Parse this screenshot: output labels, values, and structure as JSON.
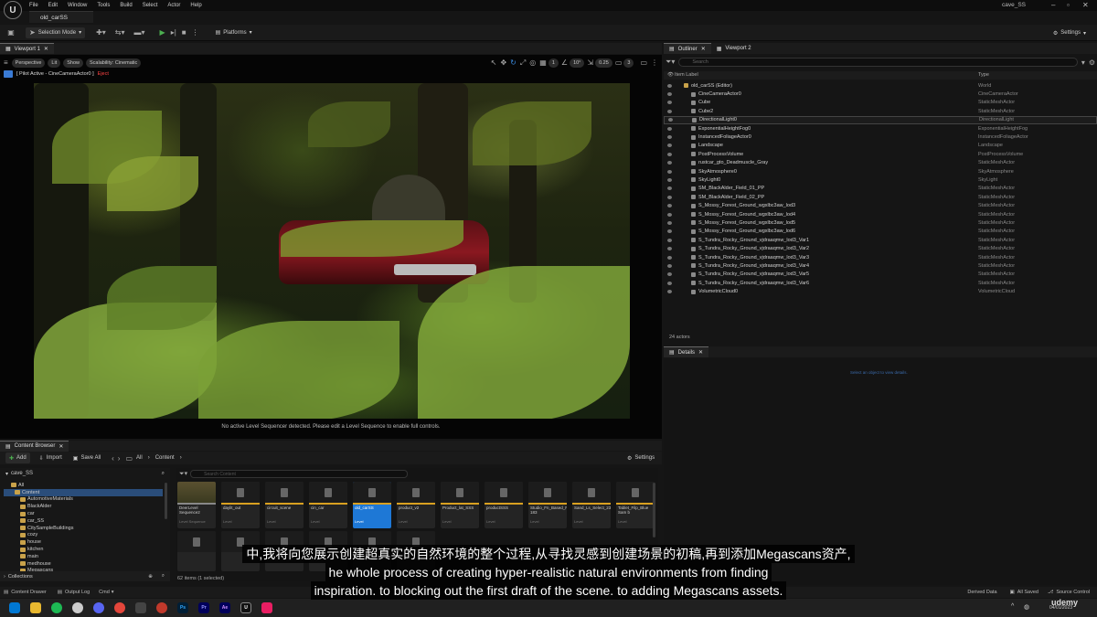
{
  "window": {
    "project_tab": "old_carSS",
    "title": "cave_SS",
    "menus": [
      "File",
      "Edit",
      "Window",
      "Tools",
      "Build",
      "Select",
      "Actor",
      "Help"
    ]
  },
  "toolbar": {
    "selection_mode": "Selection Mode",
    "platforms": "Platforms",
    "settings": "Settings"
  },
  "viewport": {
    "tab": "Viewport 1",
    "perspective": "Perspective",
    "lit": "Lit",
    "show": "Show",
    "scalability": "Scalability: Cinematic",
    "pilot": "[ Pilot Active - CineCameraActor0 ]",
    "eject": "Eject",
    "grid_snap": "10",
    "rot_snap": "10°",
    "scale_snap": "0.25",
    "cam_speed": "3",
    "grid_num": "1",
    "message": "No active Level Sequencer detected. Please edit a Level Sequence to enable full controls."
  },
  "outliner": {
    "tab": "Outliner",
    "tab2": "Viewport 2",
    "search_placeholder": "Search",
    "col_label": "Item Label",
    "col_type": "Type",
    "root": "old_carSS (Editor)",
    "root_type": "World",
    "items": [
      {
        "name": "CineCameraActor0",
        "type": "CineCameraActor"
      },
      {
        "name": "Cube",
        "type": "StaticMeshActor"
      },
      {
        "name": "Cube2",
        "type": "StaticMeshActor"
      },
      {
        "name": "DirectionalLight0",
        "type": "DirectionalLight"
      },
      {
        "name": "ExponentialHeightFog0",
        "type": "ExponentialHeightFog"
      },
      {
        "name": "InstancedFoliageActor0",
        "type": "InstancedFoliageActor"
      },
      {
        "name": "Landscape",
        "type": "Landscape"
      },
      {
        "name": "PostProcessVolume",
        "type": "PostProcessVolume"
      },
      {
        "name": "rustcar_gto_Deadmuscle_Gray",
        "type": "StaticMeshActor"
      },
      {
        "name": "SkyAtmosphere0",
        "type": "SkyAtmosphere"
      },
      {
        "name": "SkyLight0",
        "type": "SkyLight"
      },
      {
        "name": "SM_BlackAlder_Field_01_PP",
        "type": "StaticMeshActor"
      },
      {
        "name": "SM_BlackAlder_Field_02_PP",
        "type": "StaticMeshActor"
      },
      {
        "name": "S_Mossy_Forest_Ground_wgxlbc3aw_lod3",
        "type": "StaticMeshActor"
      },
      {
        "name": "S_Mossy_Forest_Ground_wgxlbc3aw_lod4",
        "type": "StaticMeshActor"
      },
      {
        "name": "S_Mossy_Forest_Ground_wgxlbc3aw_lod5",
        "type": "StaticMeshActor"
      },
      {
        "name": "S_Mossy_Forest_Ground_wgxlbc3aw_lod6",
        "type": "StaticMeshActor"
      },
      {
        "name": "S_Tundra_Rocky_Ground_vjdraaqmw_lod3_Var1",
        "type": "StaticMeshActor"
      },
      {
        "name": "S_Tundra_Rocky_Ground_vjdraaqmw_lod3_Var2",
        "type": "StaticMeshActor"
      },
      {
        "name": "S_Tundra_Rocky_Ground_vjdraaqmw_lod3_Var3",
        "type": "StaticMeshActor"
      },
      {
        "name": "S_Tundra_Rocky_Ground_vjdraaqmw_lod3_Var4",
        "type": "StaticMeshActor"
      },
      {
        "name": "S_Tundra_Rocky_Ground_vjdraaqmw_lod3_Var5",
        "type": "StaticMeshActor"
      },
      {
        "name": "S_Tundra_Rocky_Ground_vjdraaqmw_lod3_Var6",
        "type": "StaticMeshActor"
      },
      {
        "name": "VolumetricCloud0",
        "type": "VolumetricCloud"
      }
    ],
    "actor_count": "24 actors"
  },
  "details": {
    "tab": "Details",
    "hint": "Select an object to view details."
  },
  "content_browser": {
    "tab": "Content Browser",
    "add": "Add",
    "import": "Import",
    "save_all": "Save All",
    "crumb_all": "All",
    "crumb_content": "Content",
    "settings": "Settings",
    "project": "cave_SS",
    "search_placeholder": "Search Content",
    "tree": [
      "All",
      "Content",
      "AutomotiveMaterials",
      "BlackAlder",
      "car",
      "car_SS",
      "CitySampleBuildings",
      "cozy",
      "house",
      "kitchen",
      "main",
      "medhouse",
      "Megascans"
    ],
    "assets": [
      {
        "name": "DeerLevel Sequence2",
        "cls": "Level Sequence"
      },
      {
        "name": "daylit_out",
        "cls": "Level"
      },
      {
        "name": "circuit_scene",
        "cls": "Level"
      },
      {
        "name": "cin_car",
        "cls": "Level"
      },
      {
        "name": "old_carSS",
        "cls": "Level"
      },
      {
        "name": "product_v2",
        "cls": "Level"
      },
      {
        "name": "Product_lat_SSS",
        "cls": "Level"
      },
      {
        "name": "productSSS",
        "cls": "Level"
      },
      {
        "name": "Studio_Fn_Based_Fe_attenuat 183",
        "cls": "Level"
      },
      {
        "name": "Sand_Ls_Select_23",
        "cls": "Level"
      },
      {
        "name": "Tablet_Filp_Blue Sam b",
        "cls": "Level"
      }
    ],
    "item_count": "62 items (1 selected)",
    "collections": "Collections"
  },
  "statusbar": {
    "content_drawer": "Content Drawer",
    "output_log": "Output Log",
    "cmd": "Cmd",
    "derived": "Derived Data",
    "saved": "All Saved",
    "source": "Source Control"
  },
  "subtitles": {
    "zh": "中,我将向您展示创建超真实的自然环境的整个过程,从寻找灵感到创建场景的初稿,再到添加Megascans资产,",
    "en1": "he whole process of creating hyper-realistic natural environments from finding",
    "en2": "inspiration. to blocking out the first draft of the scene. to adding Megascans assets."
  },
  "watermark": "udemy",
  "clock": {
    "date": "04/01/2023"
  },
  "colors": {
    "accent": "#1e78d6",
    "folder": "#c9a24a",
    "level_stripe": "#d9a020"
  }
}
